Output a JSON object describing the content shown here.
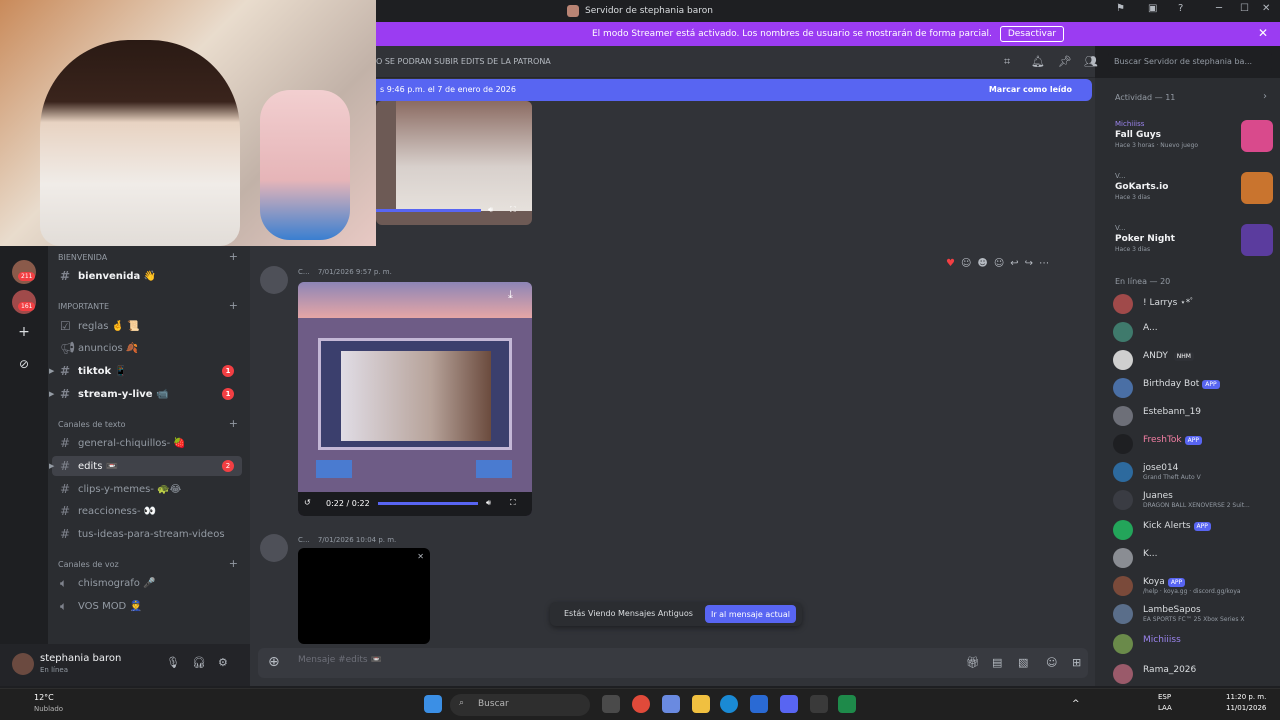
{
  "window": {
    "title": "Servidor de stephania baron"
  },
  "banner": {
    "text": "El modo Streamer está activado. Los nombres de usuario se mostrarán de forma parcial.",
    "button": "Desactivar"
  },
  "header": {
    "topic": "O SE PODRAN SUBIR EDITS DE LA PATRONA",
    "search_placeholder": "Buscar Servidor de stephania ba..."
  },
  "newbar": {
    "left": "s 9:46 p.m. el 7 de enero de 2026",
    "right": "Marcar como leído"
  },
  "servers": [
    {
      "badge": "211"
    },
    {
      "badge": "161"
    }
  ],
  "channels": {
    "cat1": "BIENVENIDA",
    "ch_bienvenida": "bienvenida 👋",
    "cat2": "IMPORTANTE",
    "ch_reglas": "reglas 🤞 📜",
    "ch_anuncios": "anuncios 🍂",
    "ch_tiktok": "tiktok 📱",
    "ch_tiktok_badge": "1",
    "ch_stream": "stream-y-live 📹",
    "ch_stream_badge": "1",
    "cat3": "Canales de texto",
    "ch_general": "general-chiquillos- 🍓",
    "ch_edits": "edits 📼",
    "ch_edits_badge": "2",
    "ch_clips": "clips-y-memes- 🐢😂",
    "ch_reacciones": "reaccioness- 👀",
    "ch_ideas": "tus-ideas-para-stream-videos",
    "cat4": "Canales de voz",
    "ch_chismografo": "chismografo 🎤",
    "ch_vosmod": "VOS MOD 👮"
  },
  "user": {
    "name": "stephania baron",
    "status": "En línea"
  },
  "messages": [
    {
      "author": "C...",
      "time": "7/01/2026 9:57 p. m.",
      "video_time": "0:22 / 0:22"
    },
    {
      "author": "C...",
      "time": "7/01/2026 10:04 p. m."
    }
  ],
  "old_messages": {
    "text": "Estás Viendo Mensajes Antiguos",
    "button": "Ir al mensaje actual"
  },
  "composer": {
    "placeholder": "Mensaje #edits 📼"
  },
  "activity": {
    "title": "Actividad — 11",
    "items": [
      {
        "who": "Michiiiss",
        "game": "Fall Guys",
        "when": "Hace 3 horas",
        "extra": "Nuevo juego"
      },
      {
        "who": "V...",
        "game": "GoKarts.io",
        "when": "Hace 3 días"
      },
      {
        "who": "V...",
        "game": "Poker Night",
        "when": "Hace 3 días"
      }
    ]
  },
  "online": {
    "title": "En línea — 20",
    "members": [
      {
        "name": "! Larrys ⋆*ﾟ",
        "sub": ""
      },
      {
        "name": "A...",
        "sub": ""
      },
      {
        "name": "ANDY",
        "sub": "",
        "tag": "NHM"
      },
      {
        "name": "Birthday Bot",
        "sub": "",
        "app": "APP"
      },
      {
        "name": "Estebann_19",
        "sub": ""
      },
      {
        "name": "FreshTok",
        "sub": "",
        "app": "APP"
      },
      {
        "name": "jose014",
        "sub": "Grand Theft Auto V"
      },
      {
        "name": "Juanes",
        "sub": "DRAGON BALL XENOVERSE 2 Suit..."
      },
      {
        "name": "Kick Alerts",
        "sub": "",
        "app": "APP"
      },
      {
        "name": "K...",
        "sub": ""
      },
      {
        "name": "Koya",
        "sub": "/help · koya.gg · discord.gg/koya",
        "app": "APP"
      },
      {
        "name": "LambeSapos",
        "sub": "EA SPORTS FC™ 25 Xbox Series X"
      },
      {
        "name": "Michiiiss",
        "sub": ""
      },
      {
        "name": "Rama_2026",
        "sub": ""
      }
    ]
  },
  "taskbar": {
    "weather_temp": "12°C",
    "weather_desc": "Nublado",
    "search": "Buscar",
    "lang": "ESP",
    "lang2": "LAA",
    "time": "11:20 p. m.",
    "date": "11/01/2026"
  },
  "colors": {
    "accent": "#5865f2",
    "banner": "#9b3cf2",
    "danger": "#f23f43",
    "bg": "#313338"
  }
}
